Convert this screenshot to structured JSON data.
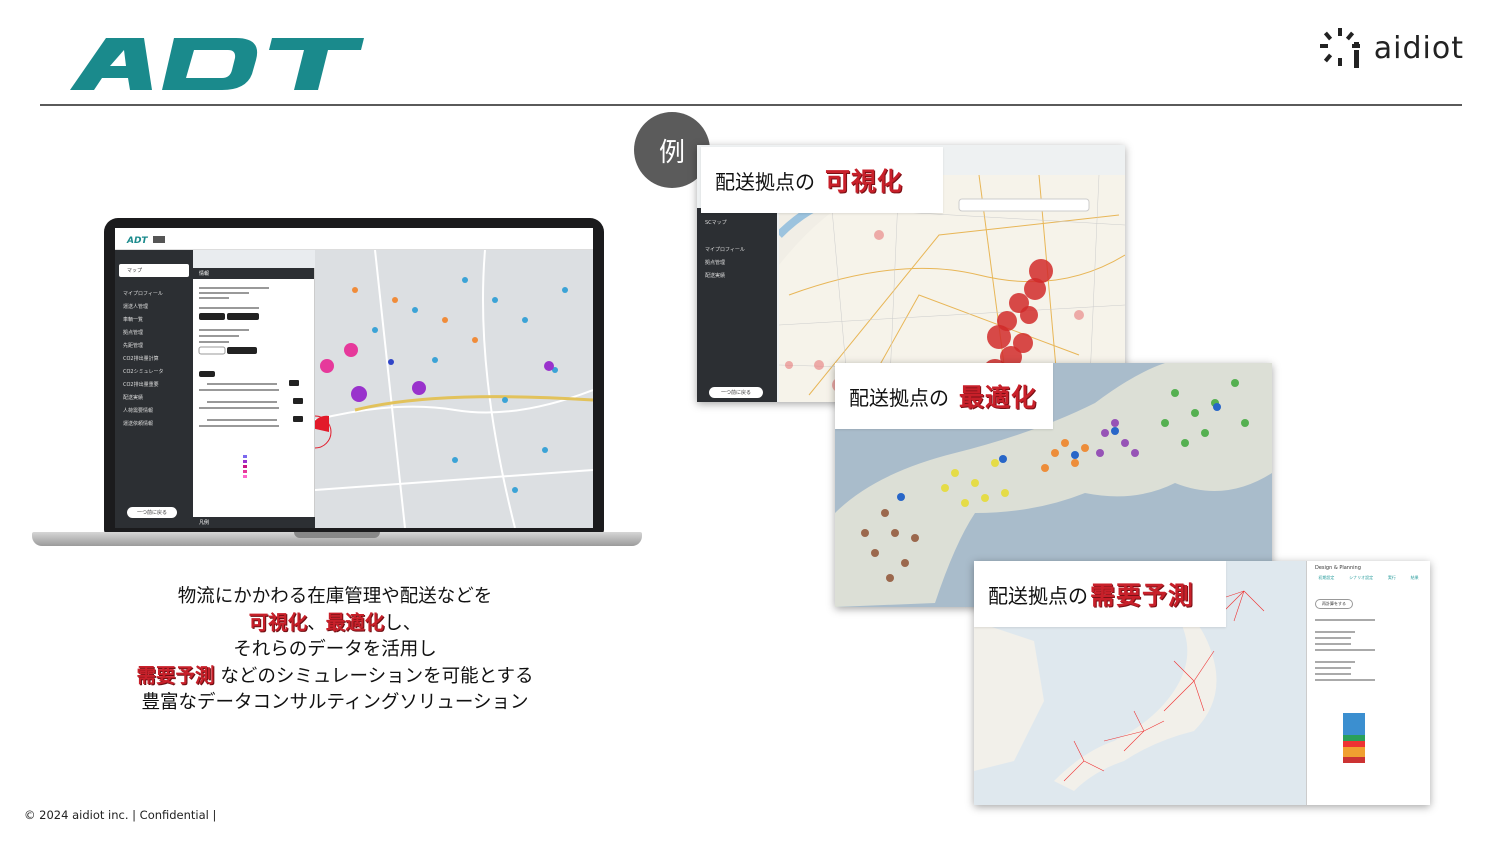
{
  "header": {
    "left_logo_text": "ADT",
    "right_logo_text": "aidiot",
    "brand_teal": "#1a8a8c"
  },
  "example_badge": "例",
  "cards": [
    {
      "plain": "配送拠点の",
      "emphasis": "可視化"
    },
    {
      "plain": "配送拠点の",
      "emphasis": "最適化"
    },
    {
      "plain": "配送拠点の",
      "emphasis": "需要予測"
    }
  ],
  "laptop_screen": {
    "sidebar_items": [
      "マップ",
      "マイプロフィール",
      "運送人管理",
      "車輌一覧",
      "拠点管理",
      "先距管理",
      "CO2排出量計算",
      "CO2シミュレータ",
      "CO2排出量重要",
      "配送実績",
      "人荷需要情報",
      "運送依頼情報"
    ],
    "back_button": "一つ前に戻る",
    "info_title": "情報",
    "legend_label": "凡例"
  },
  "card1_sidebar": [
    "SCマップ",
    "マイプロフィール",
    "拠点管理",
    "配送実績"
  ],
  "card1_back": "一つ前に戻る",
  "card3_panel": {
    "title": "Design & Planning",
    "steps": [
      "初期設定",
      "シナリオ設定",
      "実行",
      "結果"
    ],
    "button": "再計算をする"
  },
  "copy": {
    "line1": "物流にかかわる在庫管理や配送などを",
    "line2_em1": "可視化",
    "line2_sep": "、",
    "line2_em2": "最適化",
    "line2_tail": "し、",
    "line3": "それらのデータを活用し",
    "line4_em": "需要予測",
    "line4_tail": "などのシミュレーションを可能とする",
    "line5": "豊富なデータコンサルティングソリューション"
  },
  "footer": "© 2024 aidiot inc. | Confidential |",
  "colors": {
    "emphasis_red": "#c8202a",
    "badge_gray": "#5b5b5b",
    "sidebar_dark": "#2c2f33"
  }
}
